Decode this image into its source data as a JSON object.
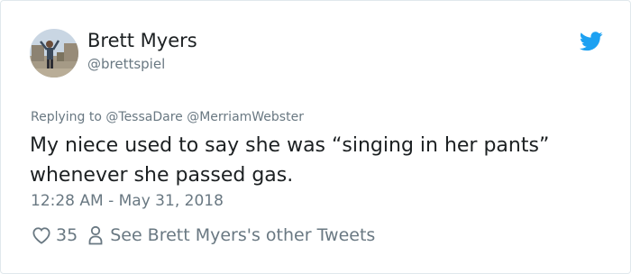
{
  "tweet": {
    "author_name": "Brett Myers",
    "author_handle": "@brettspiel",
    "replying_prefix": "Replying to",
    "reply_mentions": [
      "@TessaDare",
      "@MerriamWebster"
    ],
    "text_lines": [
      "My niece used to say she was “singing in her pants”",
      "whenever she passed gas."
    ],
    "timestamp": "12:28 AM - May 31, 2018",
    "like_count": "35",
    "other_tweets_link": "See Brett Myers's other Tweets"
  },
  "colors": {
    "twitter_blue": "#1da1f2",
    "secondary_text": "#697882",
    "primary_text": "#1c2022",
    "border": "#e1e8ed"
  },
  "icons": {
    "brand": "twitter-bird-icon",
    "like": "heart-icon",
    "profile": "person-icon"
  }
}
